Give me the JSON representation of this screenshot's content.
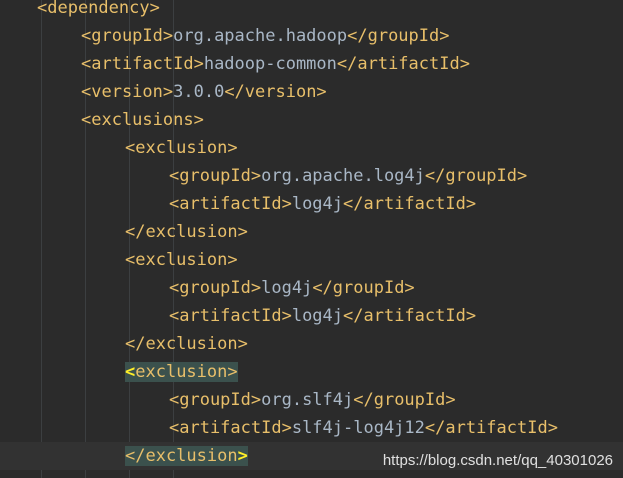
{
  "code_lines": [
    {
      "indent": 1,
      "open": "<dependency>",
      "text": "",
      "close": ""
    },
    {
      "indent": 2,
      "open": "<groupId>",
      "text": "org.apache.hadoop",
      "close": "</groupId>"
    },
    {
      "indent": 2,
      "open": "<artifactId>",
      "text": "hadoop-common",
      "close": "</artifactId>"
    },
    {
      "indent": 2,
      "open": "<version>",
      "text": "3.0.0",
      "close": "</version>"
    },
    {
      "indent": 2,
      "open": "<exclusions>",
      "text": "",
      "close": ""
    },
    {
      "indent": 3,
      "open": "<exclusion>",
      "text": "",
      "close": ""
    },
    {
      "indent": 4,
      "open": "<groupId>",
      "text": "org.apache.log4j",
      "close": "</groupId>"
    },
    {
      "indent": 4,
      "open": "<artifactId>",
      "text": "log4j",
      "close": "</artifactId>"
    },
    {
      "indent": 3,
      "open": "</exclusion>",
      "text": "",
      "close": ""
    },
    {
      "indent": 3,
      "open": "<exclusion>",
      "text": "",
      "close": ""
    },
    {
      "indent": 4,
      "open": "<groupId>",
      "text": "log4j",
      "close": "</groupId>"
    },
    {
      "indent": 4,
      "open": "<artifactId>",
      "text": "log4j",
      "close": "</artifactId>"
    },
    {
      "indent": 3,
      "open": "</exclusion>",
      "text": "",
      "close": ""
    },
    {
      "indent": 3,
      "open": "<exclusion>",
      "text": "",
      "close": "",
      "highlight": true,
      "bracket": "start"
    },
    {
      "indent": 4,
      "open": "<groupId>",
      "text": "org.slf4j",
      "close": "</groupId>"
    },
    {
      "indent": 4,
      "open": "<artifactId>",
      "text": "slf4j-log4j12",
      "close": "</artifactId>"
    },
    {
      "indent": 3,
      "open": "</exclusion>",
      "text": "",
      "close": "",
      "highlight": true,
      "bracket": "end",
      "current": true
    }
  ],
  "watermark": "https://blog.csdn.net/qq_40301026",
  "colors": {
    "background": "#2b2b2b",
    "tag": "#e8bf6a",
    "text": "#a9b7c6",
    "tag_match_highlight": "#3b514d",
    "bracket_match": "#ffef28"
  }
}
